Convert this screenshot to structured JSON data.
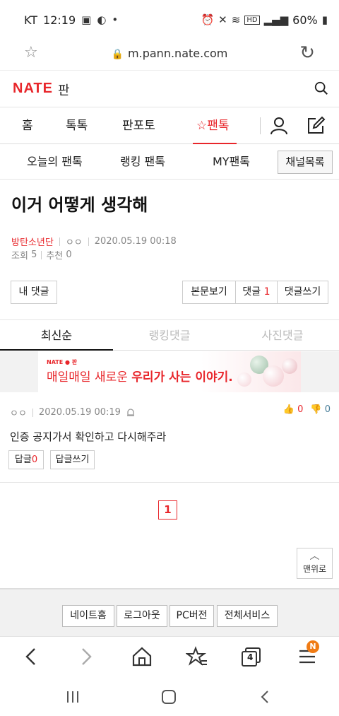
{
  "status_bar": {
    "carrier": "KT",
    "time": "12:19",
    "battery": "60%"
  },
  "browser": {
    "url": "m.pann.nate.com"
  },
  "header": {
    "logo": "NATE",
    "sub": "판"
  },
  "gnb": {
    "tabs": [
      "홈",
      "톡톡",
      "판포토",
      "팬톡"
    ],
    "active": "팬톡"
  },
  "subnav": {
    "items": [
      "오늘의 팬톡",
      "랭킹 팬톡",
      "MY팬톡"
    ],
    "channel_button": "채널목록"
  },
  "post": {
    "title": "이거 어떻게 생각해",
    "category": "방탄소년단",
    "author": "ㅇㅇ",
    "date": "2020.05.19 00:18",
    "views_label": "조회",
    "views": "5",
    "recommend_label": "추천",
    "recommend": "0"
  },
  "actions": {
    "my_comments": "내 댓글",
    "view_body": "본문보기",
    "comments_label": "댓글",
    "comments_count": "1",
    "write_comment": "댓글쓰기"
  },
  "comment_tabs": [
    "최신순",
    "랭킹댓글",
    "사진댓글"
  ],
  "banner": {
    "brand": "NATE ● 판",
    "text_plain": "매일매일 새로운 ",
    "text_bold": "우리가 사는 이야기."
  },
  "comment": {
    "author": "ㅇㅇ",
    "date": "2020.05.19 00:19",
    "up": "0",
    "down": "0",
    "body": "인증 공지가서 확인하고 다시해주라",
    "reply_label": "답글",
    "reply_count": "0",
    "reply_write": "답글쓰기"
  },
  "pager": {
    "current": "1"
  },
  "top_button": "맨위로",
  "footer": [
    "네이트홈",
    "로그아웃",
    "PC버전",
    "전체서비스"
  ],
  "browser_nav": {
    "tabs_count": "4",
    "badge": "N"
  },
  "colors": {
    "accent": "#e8262b",
    "badge": "#f07b14"
  }
}
